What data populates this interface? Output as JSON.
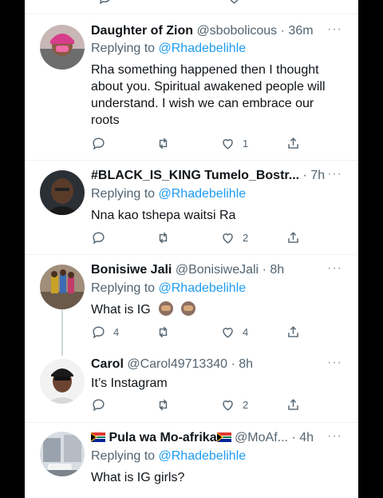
{
  "tweets": [
    {
      "name": "Daughter of Zion",
      "handle": "@sbobolicous",
      "time": "· 36m",
      "more": "···",
      "replying_prefix": "Replying to ",
      "replying_to": "@Rhadebelihle",
      "text": "Rha something happened then I thought about you. Spiritual awakened people will understand. I wish we can embrace our roots",
      "counts": {
        "reply": "",
        "retweet": "",
        "like": "1"
      }
    },
    {
      "name": "#BLACK_IS_KING Tumelo_Bostr...",
      "handle": "",
      "time": "· 7h",
      "more": "···",
      "replying_prefix": "Replying to ",
      "replying_to": "@Rhadebelihle",
      "text": "Nna kao tshepa waitsi Ra",
      "counts": {
        "reply": "",
        "retweet": "",
        "like": "2"
      }
    },
    {
      "name": "Bonisiwe Jali",
      "handle": "@BonisiweJali",
      "time": "· 8h",
      "more": "···",
      "replying_prefix": "Replying to ",
      "replying_to": "@Rhadebelihle",
      "text": "What is IG",
      "emoji": [
        "see-no-evil-monkey",
        "see-no-evil-monkey"
      ],
      "counts": {
        "reply": "4",
        "retweet": "",
        "like": "4"
      }
    },
    {
      "name": "Carol",
      "handle": "@Carol49713340",
      "time": "· 8h",
      "more": "···",
      "text": "It’s Instagram",
      "counts": {
        "reply": "",
        "retweet": "",
        "like": "2"
      }
    },
    {
      "name": "Pula wa Mo-afrika",
      "handle": "@MoAf...",
      "time": "· 4h",
      "more": "···",
      "replying_prefix": "Replying to ",
      "replying_to": "@Rhadebelihle",
      "text": "What is IG girls?",
      "flags": [
        "south-africa-flag",
        "south-africa-flag"
      ]
    }
  ],
  "colors": {
    "link": "#1d9bf0",
    "secondary": "#536471",
    "text": "#0f1419"
  }
}
